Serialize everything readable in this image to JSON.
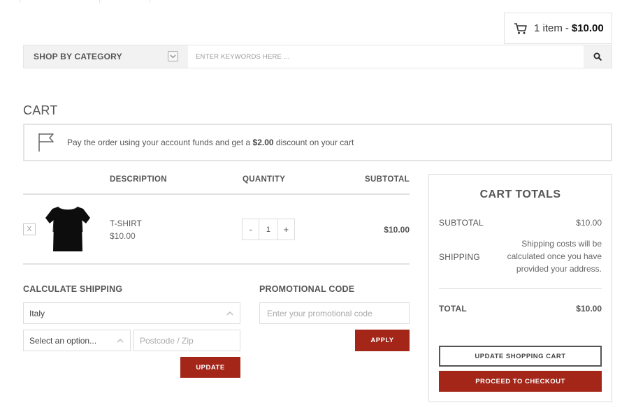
{
  "mini_cart": {
    "count": "1 item",
    "separator": "-",
    "total": "$10.00"
  },
  "search": {
    "category_label": "SHOP BY CATEGORY",
    "placeholder": "ENTER KEYWORDS HERE ..."
  },
  "page_title": "CART",
  "notice": {
    "prefix": "Pay the order using your account funds and get a",
    "discount": "$2.00",
    "suffix": "discount on your cart"
  },
  "cart_table": {
    "headers": {
      "description": "DESCRIPTION",
      "quantity": "QUANTITY",
      "subtotal": "SUBTOTAL"
    },
    "items": [
      {
        "remove": "X",
        "name": "T-SHIRT",
        "price": "$10.00",
        "quantity": "1",
        "minus": "-",
        "plus": "+",
        "subtotal": "$10.00"
      }
    ]
  },
  "shipping": {
    "title": "CALCULATE SHIPPING",
    "country": "Italy",
    "state": "Select an option...",
    "postcode_placeholder": "Postcode / Zip",
    "update_label": "UPDATE"
  },
  "promo": {
    "title": "PROMOTIONAL CODE",
    "placeholder": "Enter your promotional code",
    "apply_label": "APPLY"
  },
  "totals": {
    "title": "CART TOTALS",
    "subtotal_label": "SUBTOTAL",
    "subtotal_value": "$10.00",
    "shipping_label": "SHIPPING",
    "shipping_value": "Shipping costs will be calculated once you have provided your address.",
    "total_label": "TOTAL",
    "total_value": "$10.00",
    "update_cart_label": "UPDATE SHOPPING CART",
    "checkout_label": "PROCEED TO CHECKOUT"
  },
  "colors": {
    "accent": "#a32619",
    "border": "#e2e2e2",
    "text": "#555555"
  }
}
